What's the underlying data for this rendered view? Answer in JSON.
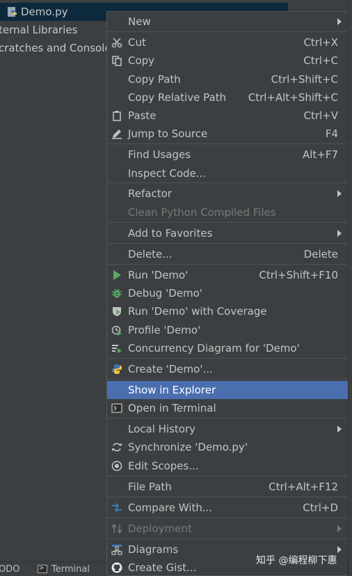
{
  "project_tree": {
    "items": [
      {
        "label": "Demo.py",
        "selected": true
      },
      {
        "label": "ternal Libraries"
      },
      {
        "label": "cratches and Consoles"
      }
    ]
  },
  "bottom_bar": {
    "left_label": "ODO",
    "terminal_label": "Terminal"
  },
  "watermark": "知乎 @编程柳下惠",
  "context_menu": {
    "new": {
      "label": "New"
    },
    "cut": {
      "label": "Cut",
      "shortcut": "Ctrl+X"
    },
    "copy": {
      "label": "Copy",
      "shortcut": "Ctrl+C"
    },
    "copy_path": {
      "label": "Copy Path",
      "shortcut": "Ctrl+Shift+C"
    },
    "copy_relative_path": {
      "label": "Copy Relative Path",
      "shortcut": "Ctrl+Alt+Shift+C"
    },
    "paste": {
      "label": "Paste",
      "shortcut": "Ctrl+V"
    },
    "jump_to_source": {
      "label": "Jump to Source",
      "shortcut": "F4"
    },
    "find_usages": {
      "label": "Find Usages",
      "shortcut": "Alt+F7"
    },
    "inspect_code": {
      "label": "Inspect Code..."
    },
    "refactor": {
      "label": "Refactor"
    },
    "clean_python": {
      "label": "Clean Python Compiled Files",
      "enabled": false
    },
    "add_to_favorites": {
      "label": "Add to Favorites"
    },
    "delete": {
      "label": "Delete...",
      "shortcut": "Delete"
    },
    "run": {
      "label": "Run 'Demo'",
      "shortcut": "Ctrl+Shift+F10"
    },
    "debug": {
      "label": "Debug 'Demo'"
    },
    "run_coverage": {
      "label": "Run 'Demo' with Coverage"
    },
    "profile": {
      "label": "Profile 'Demo'"
    },
    "concurrency": {
      "label": "Concurrency Diagram for 'Demo'"
    },
    "create": {
      "label": "Create 'Demo'..."
    },
    "show_in_explorer": {
      "label": "Show in Explorer",
      "selected": true
    },
    "open_in_terminal": {
      "label": "Open in Terminal"
    },
    "local_history": {
      "label": "Local History"
    },
    "synchronize": {
      "label": "Synchronize 'Demo.py'"
    },
    "edit_scopes": {
      "label": "Edit Scopes..."
    },
    "file_path": {
      "label": "File Path",
      "shortcut": "Ctrl+Alt+F12"
    },
    "compare_with": {
      "label": "Compare With...",
      "shortcut": "Ctrl+D"
    },
    "deployment": {
      "label": "Deployment",
      "enabled": false
    },
    "diagrams": {
      "label": "Diagrams"
    },
    "create_gist": {
      "label": "Create Gist..."
    }
  },
  "colors": {
    "menu_bg": "#3c3f41",
    "selection": "#4b6eaf",
    "tree_selection": "#0d293e",
    "run_green": "#59a869",
    "python_blue": "#3b79b4",
    "python_yellow": "#f3c53b"
  }
}
